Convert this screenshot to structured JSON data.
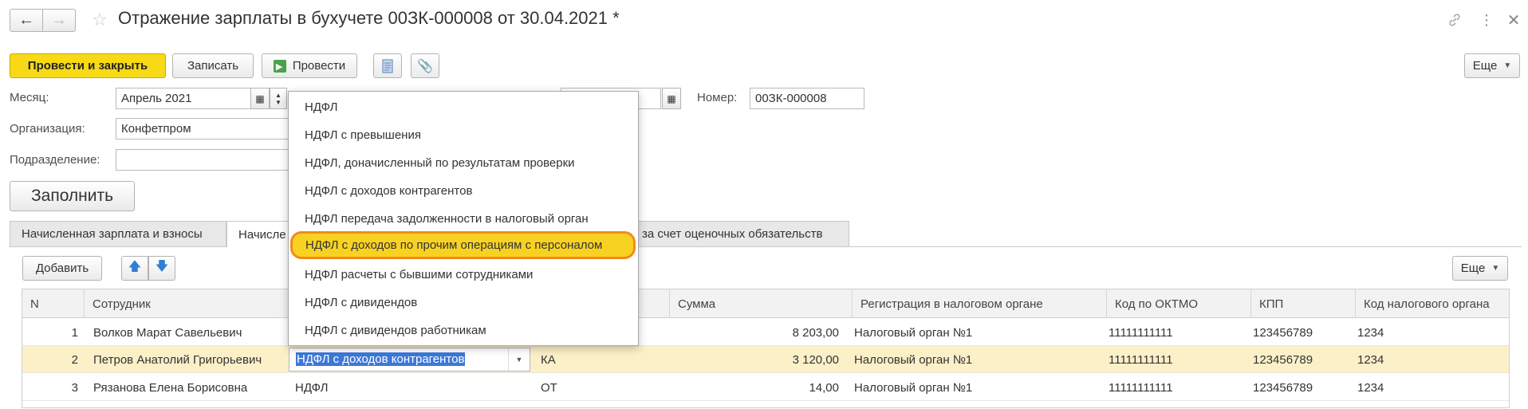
{
  "window": {
    "title": "Отражение зарплаты в бухучете 00ЗК-000008 от 30.04.2021 *"
  },
  "toolbar": {
    "post_close": "Провести и закрыть",
    "save": "Записать",
    "post": "Провести",
    "more": "Еще"
  },
  "form": {
    "month_label": "Месяц:",
    "month_value": "Апрель 2021",
    "org_label": "Организация:",
    "org_value": "Конфетпром",
    "dept_label": "Подразделение:",
    "dept_value": "",
    "number_label": "Номер:",
    "number_value": "00ЗК-000008",
    "fill_button": "Заполнить"
  },
  "tabs": [
    {
      "label": "Начисленная зарплата и взносы"
    },
    {
      "label": "Начисле"
    },
    {
      "label": "за счет оценочных обязательств"
    }
  ],
  "table_toolbar": {
    "add": "Добавить",
    "more": "Еще"
  },
  "table": {
    "headers": [
      "N",
      "Сотрудник",
      "Сумма",
      "Регистрация в налоговом органе",
      "Код по ОКТМО",
      "КПП",
      "Код налогового органа"
    ],
    "rows": [
      {
        "n": "1",
        "employee": "Волков Марат Савельевич",
        "type": "",
        "code": "",
        "sum": "8 203,00",
        "reg": "Налоговый орган №1",
        "oktmo": "11111111111",
        "kpp": "123456789",
        "tax_code": "1234"
      },
      {
        "n": "2",
        "employee": "Петров Анатолий Григорьевич",
        "type": "НДФЛ с доходов контрагентов",
        "code": "КА",
        "sum": "3 120,00",
        "reg": "Налоговый орган №1",
        "oktmo": "11111111111",
        "kpp": "123456789",
        "tax_code": "1234"
      },
      {
        "n": "3",
        "employee": "Рязанова Елена Борисовна",
        "type": "НДФЛ",
        "code": "ОТ",
        "sum": "14,00",
        "reg": "Налоговый орган №1",
        "oktmo": "11111111111",
        "kpp": "123456789",
        "tax_code": "1234"
      }
    ]
  },
  "dropdown": {
    "options": [
      "НДФЛ",
      "НДФЛ с превышения",
      "НДФЛ, доначисленный по результатам проверки",
      "НДФЛ с доходов контрагентов",
      "НДФЛ передача задолженности в налоговый орган",
      "НДФЛ с доходов по прочим операциям с персоналом",
      "НДФЛ расчеты с бывшими сотрудниками",
      "НДФЛ с дивидендов",
      "НДФЛ с дивидендов работникам"
    ],
    "highlighted_index": 5
  },
  "colors": {
    "primary_button": "#f7d917",
    "selected_row": "#fbf0c8",
    "highlight_ring": "#f28b1b"
  }
}
